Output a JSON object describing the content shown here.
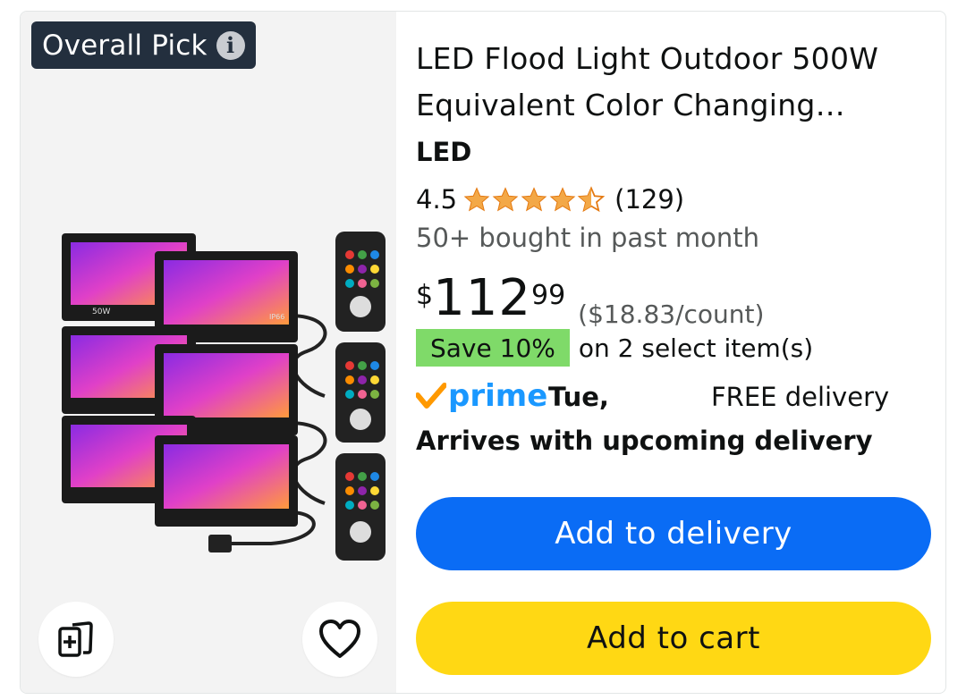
{
  "badge": {
    "label": "Overall Pick",
    "info_glyph": "i"
  },
  "product": {
    "title": "LED Flood Light Outdoor 500W Equivalent Color Changing…",
    "brand": "LED",
    "rating": "4.5",
    "rating_value": 4.5,
    "review_count": "(129)",
    "bought": "50+ bought in past month",
    "price_symbol": "$",
    "price_whole": "112",
    "price_fraction": "99",
    "unit_price": "($18.83/count)",
    "save_badge": "Save 10%",
    "save_text": "on 2 select item(s)",
    "prime_label": "prime",
    "delivery_day": "Tue,",
    "delivery_free": "FREE delivery",
    "arrives": "Arrives with upcoming delivery",
    "image_labels": {
      "watt": "50W",
      "ip": "IP66"
    }
  },
  "actions": {
    "add_to_delivery": "Add to delivery",
    "add_to_cart": "Add to cart"
  },
  "icons": {
    "info": "info-icon",
    "compare": "compare-icon",
    "wishlist": "heart-icon",
    "star": "star-icon",
    "prime_check": "prime-check-icon"
  },
  "colors": {
    "badge_bg": "#232f3e",
    "star": "#f3a847",
    "save_bg": "#7fda69",
    "prime": "#1a98ff",
    "prime_check": "#ff9900",
    "delivery_button": "#0a6cf5",
    "cart_button": "#ffd814"
  }
}
